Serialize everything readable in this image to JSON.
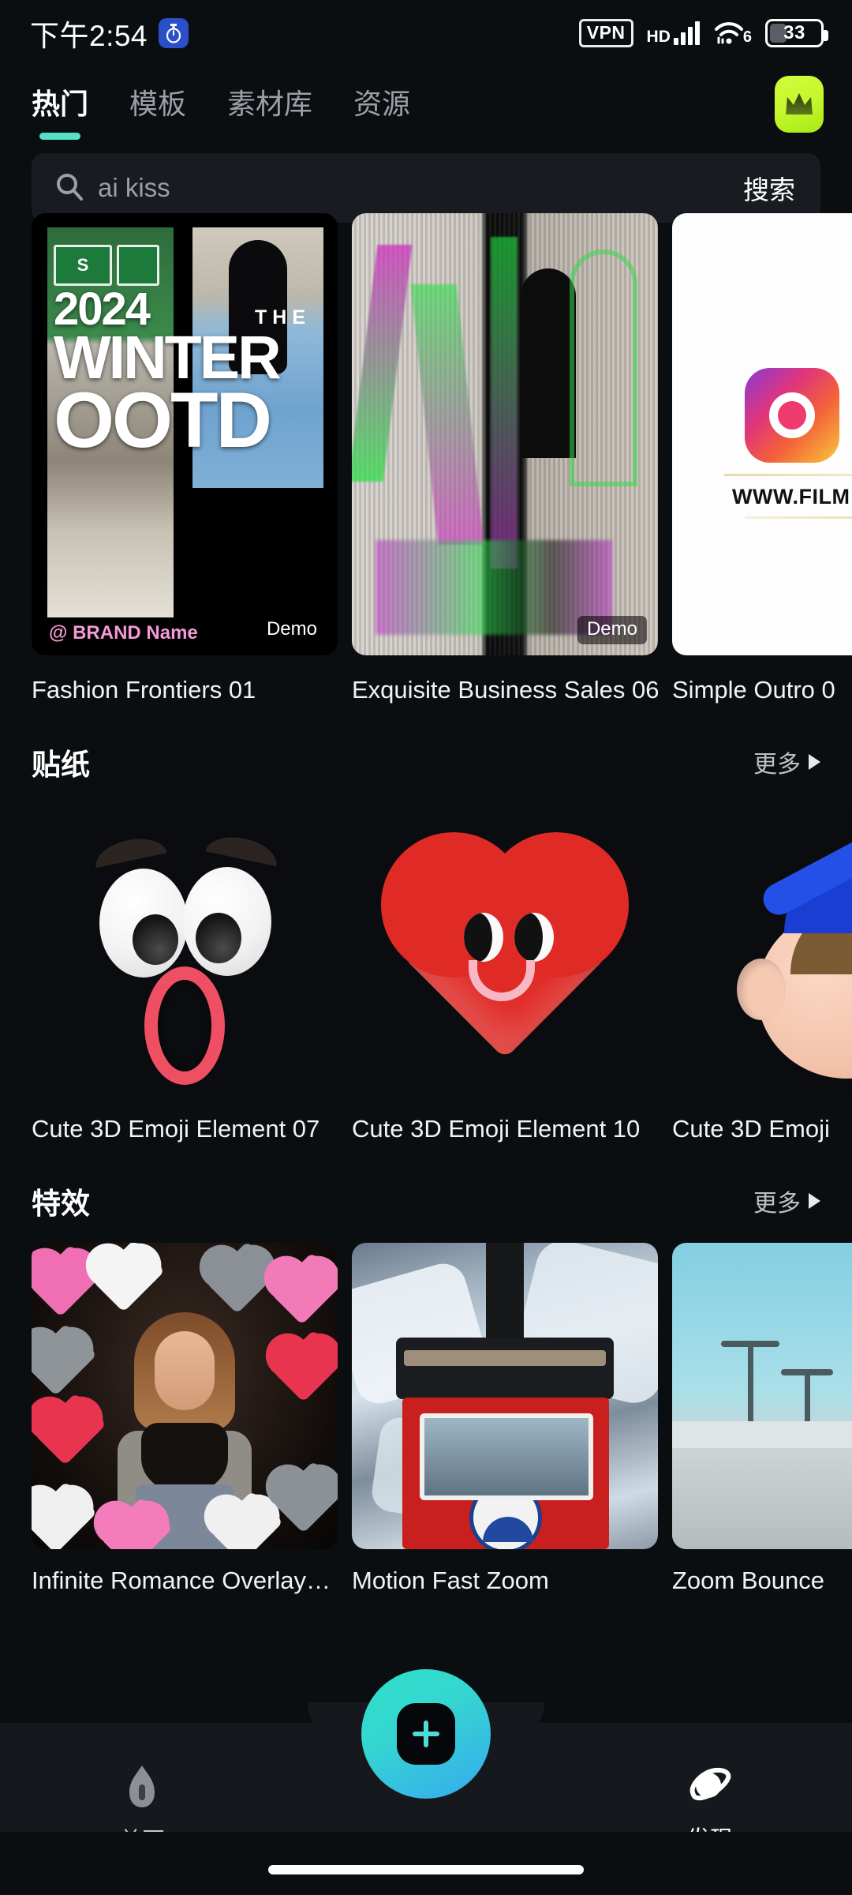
{
  "status_bar": {
    "clock": "下午2:54",
    "app_badge_icon": "stopwatch-icon",
    "vpn_label": "VPN",
    "hd_label": "HD",
    "signal_icon": "signal-bars-icon",
    "wifi_icon": "wifi-icon",
    "wifi_generation": "6",
    "battery_percent": "33"
  },
  "header": {
    "tabs": [
      {
        "label": "热门",
        "active": true
      },
      {
        "label": "模板",
        "active": false
      },
      {
        "label": "素材库",
        "active": false
      },
      {
        "label": "资源",
        "active": false
      }
    ],
    "vip_icon": "crown-icon",
    "active_indicator_color": "#56e0c8",
    "vip_badge_color": "#c2f72a"
  },
  "search": {
    "icon": "search-icon",
    "value": "",
    "placeholder": "ai kiss",
    "button_label": "搜索"
  },
  "templates": {
    "items": [
      {
        "title": "Fashion Frontiers 01",
        "badge": "Demo",
        "overlay_year": "2024",
        "overlay_the": "THE",
        "overlay_line1": "WINTER",
        "overlay_line2": "OOTD",
        "overlay_brand": "@ BRAND Name",
        "sign_text": "S"
      },
      {
        "title": "Exquisite Business Sales 06",
        "badge": "Demo"
      },
      {
        "title": "Simple Outro 0",
        "badge": "",
        "url_text": "WWW.FILM"
      }
    ]
  },
  "sections": [
    {
      "title": "贴纸",
      "more_label": "更多",
      "more_icon": "triangle-right-icon",
      "items": [
        {
          "title": "Cute 3D Emoji Element 07"
        },
        {
          "title": "Cute 3D Emoji Element 10"
        },
        {
          "title": "Cute 3D Emoji"
        }
      ]
    },
    {
      "title": "特效",
      "more_label": "更多",
      "more_icon": "triangle-right-icon",
      "items": [
        {
          "title": "Infinite Romance Overlay…"
        },
        {
          "title": "Motion Fast Zoom"
        },
        {
          "title": "Zoom Bounce"
        }
      ]
    }
  ],
  "bottom_nav": {
    "home": {
      "label": "首页",
      "icon": "home-icon",
      "active": false
    },
    "create": {
      "icon": "plus-icon",
      "gradient_from": "#2de0c8",
      "gradient_to": "#37a9f0"
    },
    "discover": {
      "label": "发现",
      "icon": "planet-icon",
      "active": true
    }
  }
}
